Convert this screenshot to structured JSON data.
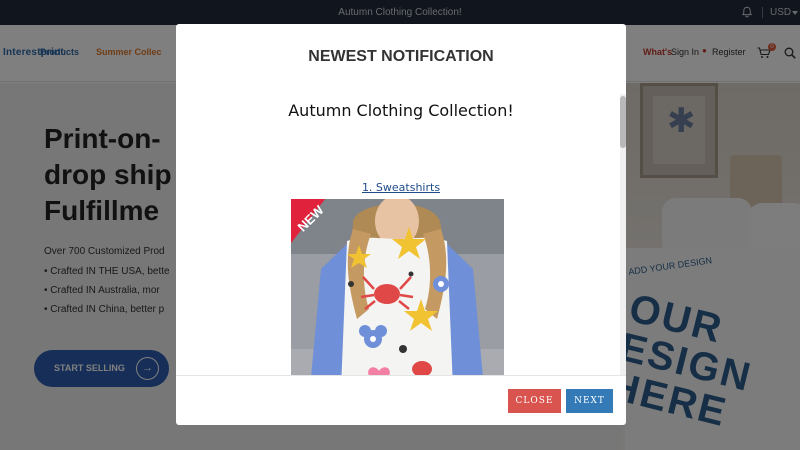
{
  "topbar": {
    "announcement": "Autumn Clothing Collection!",
    "currency": "USD"
  },
  "header": {
    "logo_text": "Interestprint",
    "nav": {
      "products": "Products",
      "summer": "Summer Collec",
      "whats_new": "What's",
      "sign_in": "Sign In",
      "register": "Register"
    },
    "cart_count": "0"
  },
  "hero": {
    "title_lines": [
      "Print-on-",
      "drop ship",
      "Fulfillme"
    ],
    "subtitle": "Over 700 Customized Prod",
    "bullets": [
      "• Crafted IN THE USA, bette",
      "• Crafted IN Australia, mor",
      "• Crafted IN China, better p"
    ],
    "cta_label": "START SELLING",
    "background_text_small": "ADD YOUR DESIGN",
    "background_text_large": [
      "OUR",
      "ESIGN",
      "HERE"
    ]
  },
  "modal": {
    "title": "NEWEST NOTIFICATION",
    "subtitle": "Autumn Clothing Collection!",
    "link_text": "1. Sweatshirts",
    "ribbon_text": "NEW",
    "close_label": "CLOSE",
    "next_label": "NEXT"
  },
  "colors": {
    "topbar_bg": "#232b3b",
    "close_button": "#d9534f",
    "next_button": "#337ab7",
    "link": "#1f4c8a",
    "cta": "#2f5fb0",
    "sleeve_blue": "#6f8fd8",
    "ribbon_red": "#e0223d"
  }
}
